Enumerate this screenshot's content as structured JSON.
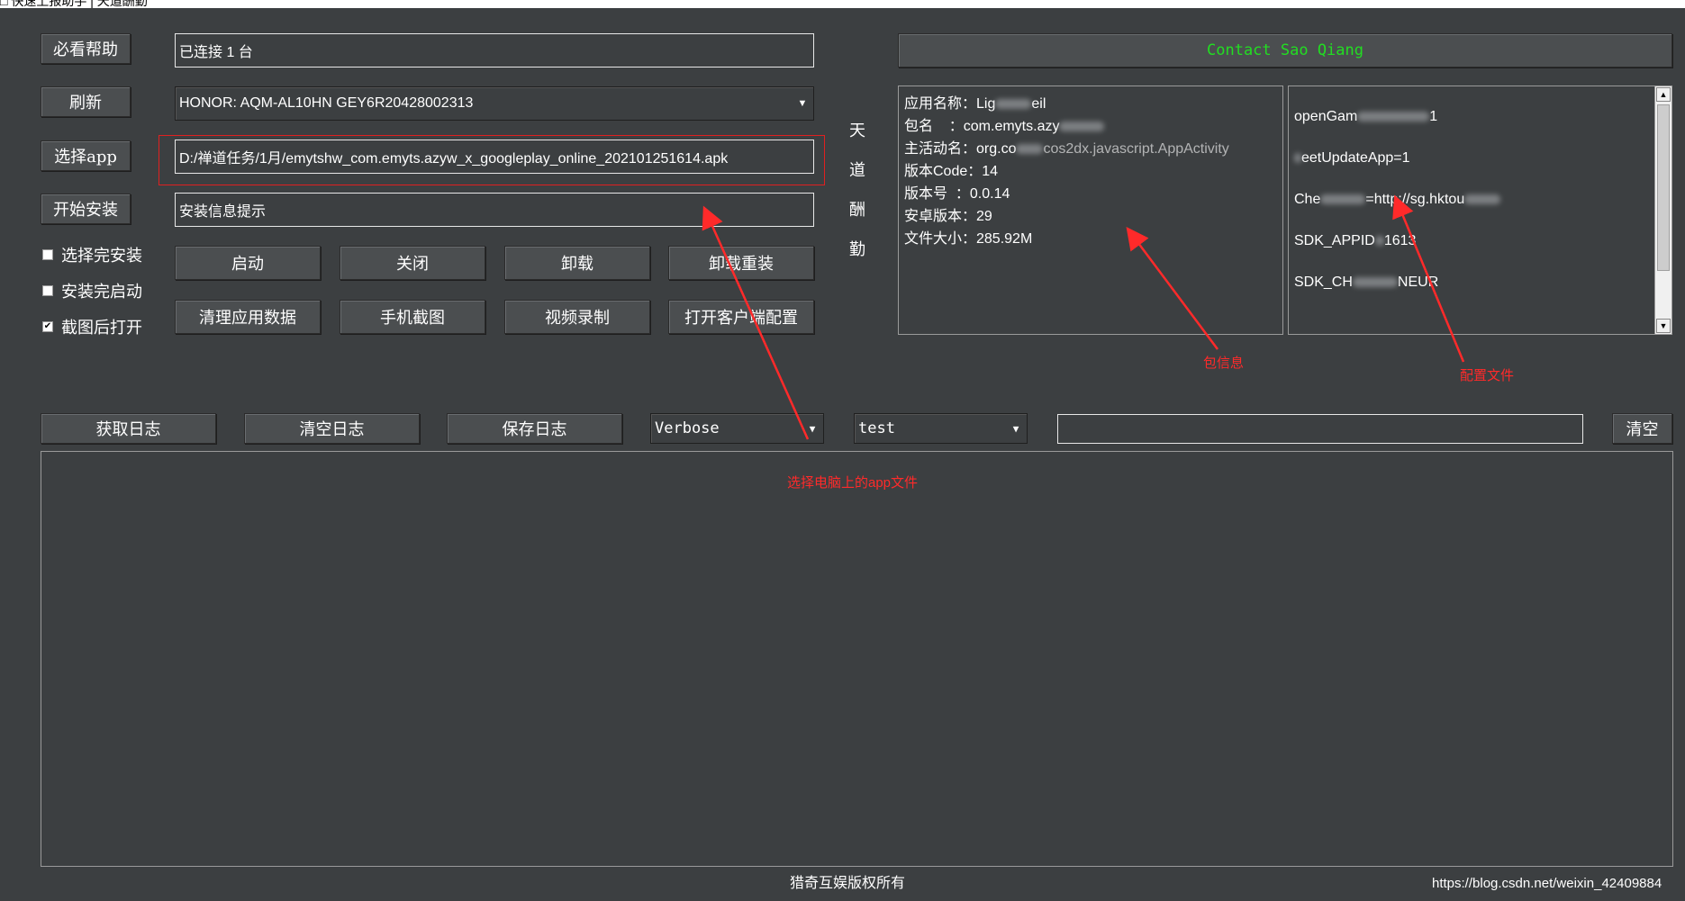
{
  "window": {
    "title": "□ 快速上报助手 | 天道酬勤"
  },
  "buttons": {
    "help": "必看帮助",
    "refresh": "刷新",
    "select_app": "选择app",
    "start_install": "开始安装",
    "launch": "启动",
    "close": "关闭",
    "uninstall": "卸载",
    "reinstall": "卸载重装",
    "clear_data": "清理应用数据",
    "screenshot": "手机截图",
    "record": "视频录制",
    "open_config": "打开客户端配置",
    "get_log": "获取日志",
    "clear_log": "清空日志",
    "save_log": "保存日志",
    "clear": "清空"
  },
  "fields": {
    "connection_status": "已连接 1 台",
    "device": "HONOR: AQM-AL10HN GEY6R20428002313",
    "apk_path": "D:/禅道任务/1月/emytshw_com.emyts.azyw_x_googleplay_online_202101251614.apk",
    "install_info": "安装信息提示",
    "log_level": "Verbose",
    "log_filter": "test",
    "search": ""
  },
  "checkboxes": [
    {
      "label": "选择完安装",
      "checked": false
    },
    {
      "label": "安装完启动",
      "checked": false
    },
    {
      "label": "截图后打开",
      "checked": true
    }
  ],
  "motto": [
    "天",
    "道",
    "酬",
    "勤"
  ],
  "contact": "Contact Sao Qiang",
  "package_info": {
    "app_name": "应用名称：Lig",
    "app_name_tail": "eil",
    "package": "包名    ：com.emyts.azy",
    "main_activity": "主活动名：org.co",
    "main_activity_tail": "cos2dx.javascript.AppActivity",
    "version_code": "版本Code：14",
    "version_name": "版本号  ：0.0.14",
    "android_version": "安卓版本：29",
    "file_size": "文件大小：285.92M"
  },
  "config_lines": [
    {
      "text": "openGam",
      "tail": "1"
    },
    {
      "text": "",
      "tail": "eetUpdateApp=1"
    },
    {
      "text": "Che",
      "tail": "=http://sg.hktou"
    },
    {
      "text": "SDK_APPID",
      "tail": "1613"
    },
    {
      "text": "SDK_CH",
      "tail": "NEUR"
    }
  ],
  "annotations": {
    "package_info": "包信息",
    "config_file": "配置文件",
    "select_app_file": "选择电脑上的app文件"
  },
  "footer": {
    "copyright": "猎奇互娱版权所有",
    "watermark": "https://blog.csdn.net/weixin_42409884"
  },
  "colors": {
    "background": "#3c3f41",
    "contact_text": "#22dd22",
    "annotation": "#ff2a2a"
  }
}
